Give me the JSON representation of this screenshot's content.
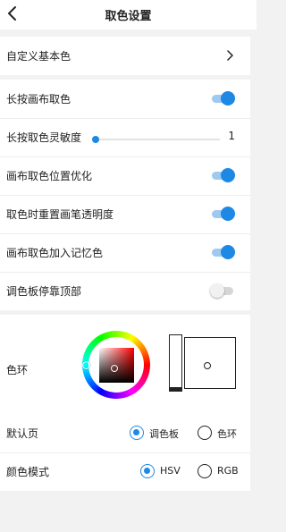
{
  "header": {
    "title": "取色设置"
  },
  "settings": {
    "custom_base_color": "自定义基本色",
    "long_press_canvas": {
      "label": "长按画布取色",
      "on": true
    },
    "sensitivity": {
      "label": "长按取色灵敏度",
      "value": "1",
      "fraction": 0.0
    },
    "position_opt": {
      "label": "画布取色位置优化",
      "on": true
    },
    "reset_opacity": {
      "label": "取色时重置画笔透明度",
      "on": true
    },
    "add_memory": {
      "label": "画布取色加入记忆色",
      "on": true
    },
    "palette_top": {
      "label": "调色板停靠顶部",
      "on": false
    }
  },
  "color_ring": {
    "label": "色环"
  },
  "default_page": {
    "label": "默认页",
    "options": [
      "调色板",
      "色环"
    ],
    "selected": "调色板"
  },
  "color_mode": {
    "label": "颜色模式",
    "options": [
      "HSV",
      "RGB"
    ],
    "selected": "HSV"
  },
  "colors": {
    "accent": "#1e88e5",
    "accent_light": "#9ec9f1",
    "background": "#f2f2f2"
  },
  "icons": {
    "back": "back-arrow-icon",
    "chevron": "chevron-right-icon"
  }
}
